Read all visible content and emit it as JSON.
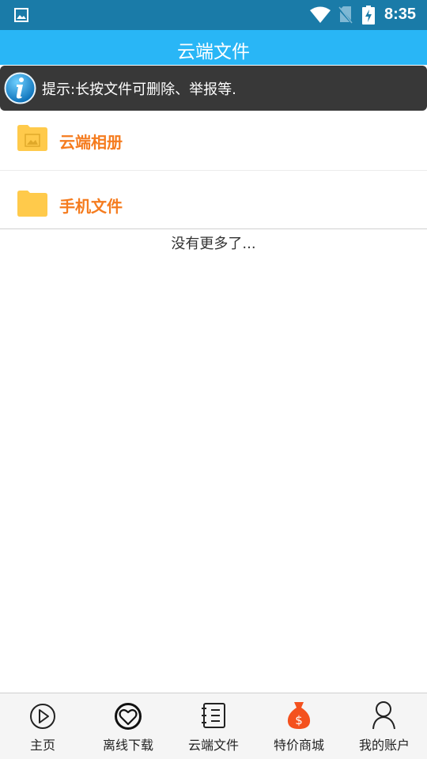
{
  "status_bar": {
    "time": "8:35",
    "icons": [
      "image-icon",
      "wifi-icon",
      "no-sim-icon",
      "battery-charging-icon"
    ]
  },
  "header": {
    "title": "云端文件"
  },
  "tip": {
    "text": "提示:长按文件可删除、举报等.",
    "icon": "info-icon"
  },
  "list": {
    "items": [
      {
        "label": "云端相册",
        "icon": "photo-folder-icon"
      },
      {
        "label": "手机文件",
        "icon": "folder-icon"
      }
    ],
    "end_text": "没有更多了..."
  },
  "bottom_nav": {
    "items": [
      {
        "label": "主页",
        "icon": "play-circle-icon"
      },
      {
        "label": "离线下载",
        "icon": "heart-circle-icon"
      },
      {
        "label": "云端文件",
        "icon": "notebook-icon"
      },
      {
        "label": "特价商城",
        "icon": "money-bag-icon"
      },
      {
        "label": "我的账户",
        "icon": "user-icon"
      }
    ]
  },
  "colors": {
    "status_bar": "#1a7ba8",
    "title_bar": "#29b6f6",
    "tip_background": "#383838",
    "item_label": "#f57c1f",
    "folder": "#ffca4b",
    "shop_icon": "#f4511e"
  }
}
